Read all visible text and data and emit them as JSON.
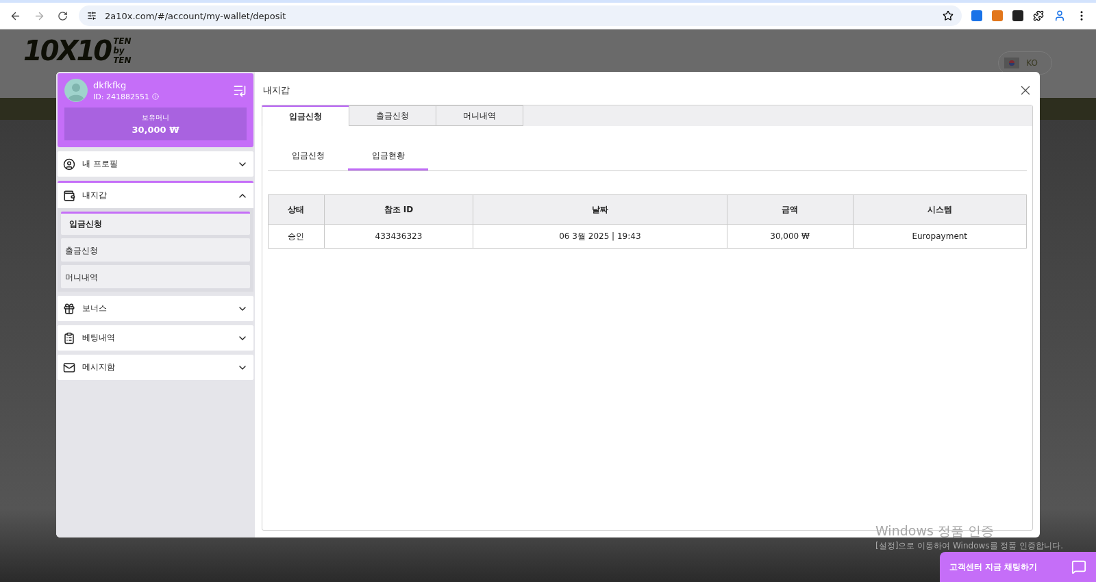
{
  "browser": {
    "url": "2a10x.com/#/account/my-wallet/deposit"
  },
  "site": {
    "logo": "10X10",
    "logo_side": [
      "TEN",
      "by",
      "TEN"
    ],
    "language": "KO"
  },
  "profile": {
    "username": "dkfkfkg",
    "id": "ID: 241882551",
    "balance_label": "보유머니",
    "balance": "30,000 ₩"
  },
  "menu": [
    {
      "label": "내 프로필",
      "expanded": false
    },
    {
      "label": "내지갑",
      "expanded": true,
      "children": [
        {
          "label": "입금신청",
          "selected": true
        },
        {
          "label": "출금신청",
          "selected": false
        },
        {
          "label": "머니내역",
          "selected": false
        }
      ]
    },
    {
      "label": "보너스",
      "expanded": false
    },
    {
      "label": "베팅내역",
      "expanded": false
    },
    {
      "label": "메시지함",
      "expanded": false
    }
  ],
  "panel": {
    "title": "내지갑",
    "tabs": [
      {
        "label": "입금신청",
        "selected": true
      },
      {
        "label": "출금신청",
        "selected": false
      },
      {
        "label": "머니내역",
        "selected": false
      }
    ],
    "subtabs": [
      {
        "label": "입금신청",
        "selected": false
      },
      {
        "label": "입금현황",
        "selected": true
      }
    ],
    "table": {
      "columns": [
        "상태",
        "참조 ID",
        "날짜",
        "금액",
        "시스템"
      ],
      "rows": [
        [
          "승인",
          "433436323",
          "06 3월 2025 | 19:43",
          "30,000 ₩",
          "Europayment"
        ]
      ]
    }
  },
  "os_notice": {
    "title": "Windows 정품 인증",
    "text": "[설정]으로 이동하여 Windows를 정품 인증합니다."
  },
  "chat": {
    "label": "고객센터 지금 채팅하기"
  }
}
